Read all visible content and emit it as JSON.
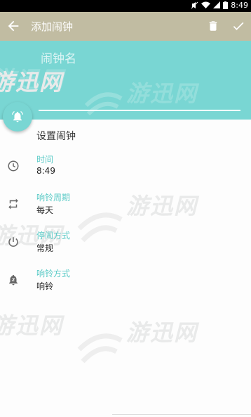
{
  "status_bar": {
    "time": "8:49"
  },
  "app_bar": {
    "title": "添加闹钟"
  },
  "name_field": {
    "placeholder": "闹钟名"
  },
  "section": {
    "title": "设置闹钟"
  },
  "settings": [
    {
      "label": "时间",
      "value": "8:49",
      "icon": "clock-icon"
    },
    {
      "label": "响铃周期",
      "value": "每天",
      "icon": "repeat-icon"
    },
    {
      "label": "停闹方式",
      "value": "常规",
      "icon": "power-icon"
    },
    {
      "label": "响铃方式",
      "value": "响铃",
      "icon": "bell-vibrate-icon"
    }
  ],
  "watermark": {
    "text": "游迅网"
  },
  "colors": {
    "appbar": "#c1bca2",
    "accent": "#79d6d3",
    "label": "#5ccbc7"
  }
}
